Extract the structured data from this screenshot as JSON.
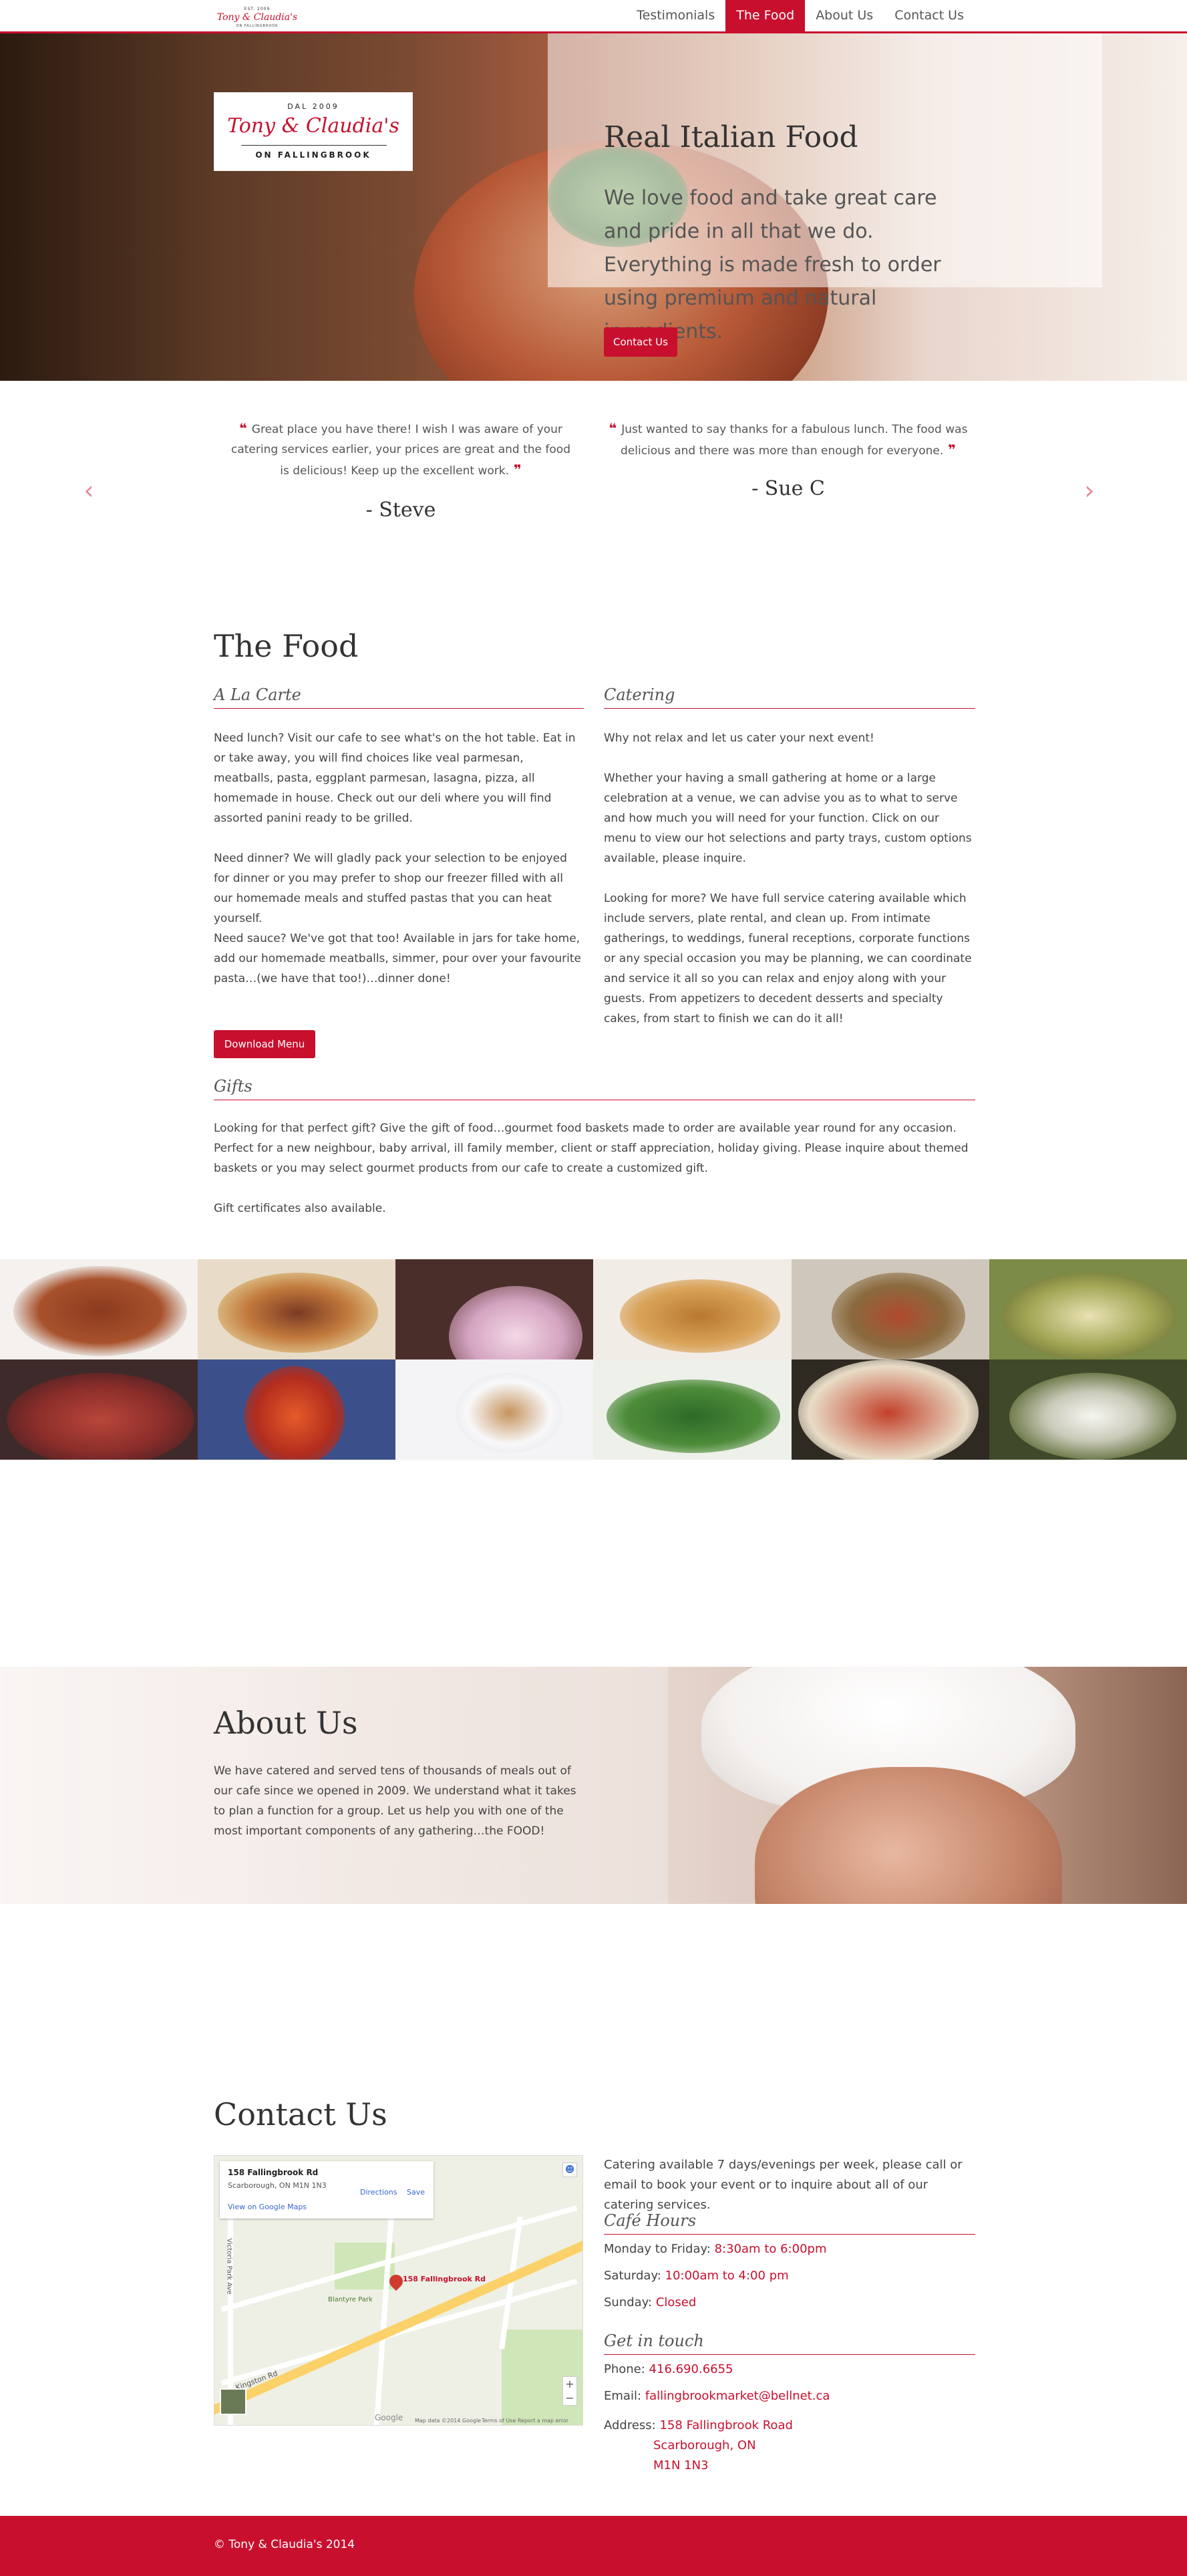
{
  "brand": {
    "est": "EST. 2009",
    "name": "Tony & Claudia's",
    "sub": "ON FALLINGBROOK",
    "logo_est": "DAL 2009"
  },
  "nav": {
    "items": [
      {
        "label": "Testimonials",
        "active": false
      },
      {
        "label": "The Food",
        "active": true
      },
      {
        "label": "About Us",
        "active": false
      },
      {
        "label": "Contact Us",
        "active": false
      }
    ]
  },
  "hero": {
    "title": "Real Italian Food",
    "text": "We love food and take great care and pride in all that we do.  Everything is made fresh to order using premium and natural ingredients.",
    "button": "Contact Us"
  },
  "testimonials": {
    "prev_icon": "‹",
    "next_icon": "›",
    "items": [
      {
        "quote": "Great place you have there!  I wish I was aware of your catering services earlier, your prices are great and the food is delicious!  Keep up the excellent work.",
        "author": "- Steve"
      },
      {
        "quote": "Just wanted to say thanks for a fabulous lunch.  The food was delicious and there was more than enough for everyone.",
        "author": "- Sue C"
      }
    ]
  },
  "food": {
    "title": "The Food",
    "alacarte": {
      "heading": "A La Carte",
      "p1": "Need lunch?  Visit our cafe to see what's on the hot table.  Eat in or take away, you will find choices like veal parmesan, meatballs, pasta, eggplant parmesan, lasagna, pizza, all homemade in house.  Check out our deli where you will find assorted panini ready to be grilled.",
      "p2": "Need dinner?  We will gladly pack your selection to be enjoyed for dinner or you may prefer to shop our freezer filled with all our homemade meals and stuffed pastas that you can heat yourself.",
      "p3": "Need sauce?  We've got that too!  Available in jars for take home, add our homemade meatballs, simmer, pour over your favourite pasta…(we have that too!)…dinner done!",
      "button": "Download Menu"
    },
    "catering": {
      "heading": "Catering",
      "p1": "Why not relax and let us cater your next event!",
      "p2": "Whether your having a small gathering at home or a large celebration at a venue, we can advise you as to what to serve and how much you will need for your function.  Click on our menu to view our hot selections and party trays, custom options available, please inquire.",
      "p3": "Looking for more?  We have full service catering available which include servers, plate rental, and clean up.  From intimate gatherings, to weddings, funeral receptions, corporate functions or any special occasion you may be planning, we can coordinate and service it all so you can relax and enjoy along with your guests.  From appetizers to decedent desserts and specialty cakes, from start to finish we can do it all!"
    },
    "gifts": {
      "heading": "Gifts",
      "p1": "Looking for that perfect gift?  Give the gift of food…gourmet food baskets made to order are available year round for any occasion.  Perfect for a new neighbour, baby arrival, ill family member, client or staff appreciation, holiday giving.  Please inquire about themed baskets or you may select gourmet products from our cafe to create a customized gift.",
      "p2": "Gift certificates also available."
    }
  },
  "about": {
    "title": "About Us",
    "text": "We have catered and served tens of thousands of meals out of our cafe since we opened in 2009.  We understand what it takes to plan a function for a group.  Let us help you with one of the most important components of any gathering…the FOOD!"
  },
  "contact": {
    "title": "Contact Us",
    "intro": "Catering available 7 days/evenings per week, please call or email to book your event or to inquire about all of our catering services.",
    "hours_heading": "Café Hours",
    "hours": [
      {
        "day": "Monday to Friday: ",
        "time": "8:30am to 6:00pm"
      },
      {
        "day": "Saturday: ",
        "time": "10:00am to 4:00 pm"
      },
      {
        "day": "Sunday: ",
        "time": "Closed"
      }
    ],
    "touch_heading": "Get in touch",
    "phone_label": "Phone: ",
    "phone": "416.690.6655",
    "email_label": "Email: ",
    "email": "fallingbrookmarket@bellnet.ca",
    "address_label": "Address: ",
    "address": [
      "158 Fallingbrook Road",
      "Scarborough, ON",
      "M1N 1N3"
    ]
  },
  "map": {
    "place": "158 Fallingbrook Rd",
    "city": "Scarborough, ON M1N 1N3",
    "directions": "Directions",
    "save": "Save",
    "view_link": "View on Google Maps",
    "pin_label": "158 Fallingbrook Rd",
    "road_kingston": "Kingston Rd",
    "road_victoria": "Victoria Park Ave",
    "park_label": "Blantyre Park",
    "footer_text": "Terms of Use   Report a map error",
    "data_text": "Map data ©2014 Google",
    "google": "Google"
  },
  "footer": {
    "text": "© Tony & Claudia's 2014"
  }
}
